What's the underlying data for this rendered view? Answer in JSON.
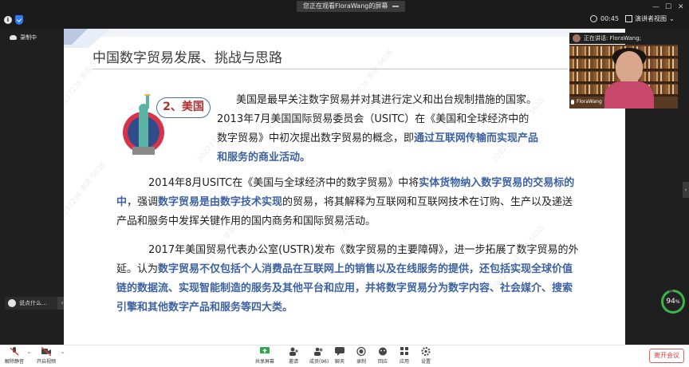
{
  "top": {
    "share_notice": "您正在观看FloraWang的屏幕",
    "elapsed": "00:45",
    "view_mode": "演讲者视图"
  },
  "left": {
    "recording": "录制中",
    "chat_placeholder": "说点什么..."
  },
  "slide": {
    "title": "中国数字贸易发展、挑战与思路",
    "section_badge": "2、美国",
    "p1_line1": "美国是最早关注数字贸易并对其进行定义和出台规制措施的国家。",
    "p1_line2": "2013年7月美国国际贸易委员会（USITC）在《美国和全球经济中的",
    "p1_line3_a": "数字贸易》中初次提出数字贸易的概念，即",
    "p1_line3_b": "通过互联网传输而实现产品",
    "p1_line4": "和服务的商业活动。",
    "p2_a": "2014年8月USITC在《美国与全球经济中的数字贸易》中将",
    "p2_b": "实体货物纳入数字贸易的交易标的中",
    "p2_c": "，强调",
    "p2_d": "数字贸易是由数字技术实现",
    "p2_e": "的贸易，将其解释为互联网和互联网技术在订购、生产以及递送产品和服务中发挥关键作用的国内商务和国际贸易活动。",
    "p3_a": "2017年美国贸易代表办公室(USTR)发布《数字贸易的主要障碍》，进一步拓展了数字贸易的外延。认为",
    "p3_b": "数字贸易不仅包括个人消费品在互联网上的销售以及在线服务的提供，还包括实现全球价值链的数据流、实现智能制造的服务及其他平台和应用，并将数字贸易分为数字内容、社会媒介、搜索引擎和其他数字产品和服务等四大类。",
    "watermark": "202237236 李笑 5638"
  },
  "right": {
    "speaking_label": "正在讲话: FloraWang;",
    "video_name": "FloraWang",
    "network_value": "94",
    "network_unit": "%"
  },
  "toolbar": {
    "mute": "解除静音",
    "video": "开启视频",
    "share": "共享屏幕",
    "invite": "邀请",
    "members": "成员(96)",
    "chat": "聊天",
    "record": "录制",
    "interact": "回应",
    "apps": "应用",
    "settings": "设置",
    "leave": "离开会议"
  },
  "colors": {
    "highlight": "#3d62a0",
    "badge_text": "#b03030",
    "leave": "#e03b3b",
    "network_good": "#3ab54a"
  }
}
